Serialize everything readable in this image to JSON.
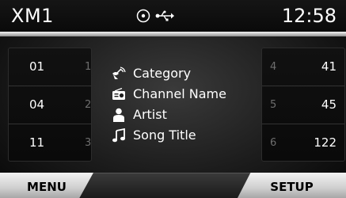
{
  "header": {
    "source_label": "XM1",
    "clock": "12:58",
    "status_icons": [
      "disc-icon",
      "usb-icon"
    ]
  },
  "presets": {
    "left": [
      {
        "number": "1",
        "channel": "01"
      },
      {
        "number": "2",
        "channel": "04"
      },
      {
        "number": "3",
        "channel": "11"
      }
    ],
    "right": [
      {
        "number": "4",
        "channel": "41"
      },
      {
        "number": "5",
        "channel": "45"
      },
      {
        "number": "6",
        "channel": "122"
      }
    ]
  },
  "info": {
    "category": "Category",
    "channel_name": "Channel Name",
    "artist": "Artist",
    "song_title": "Song Title"
  },
  "footer": {
    "menu_label": "MENU",
    "setup_label": "SETUP"
  },
  "colors": {
    "header_rule": "#cfcfcf",
    "text": "#ffffff",
    "preset_number": "#6e6e6e"
  }
}
